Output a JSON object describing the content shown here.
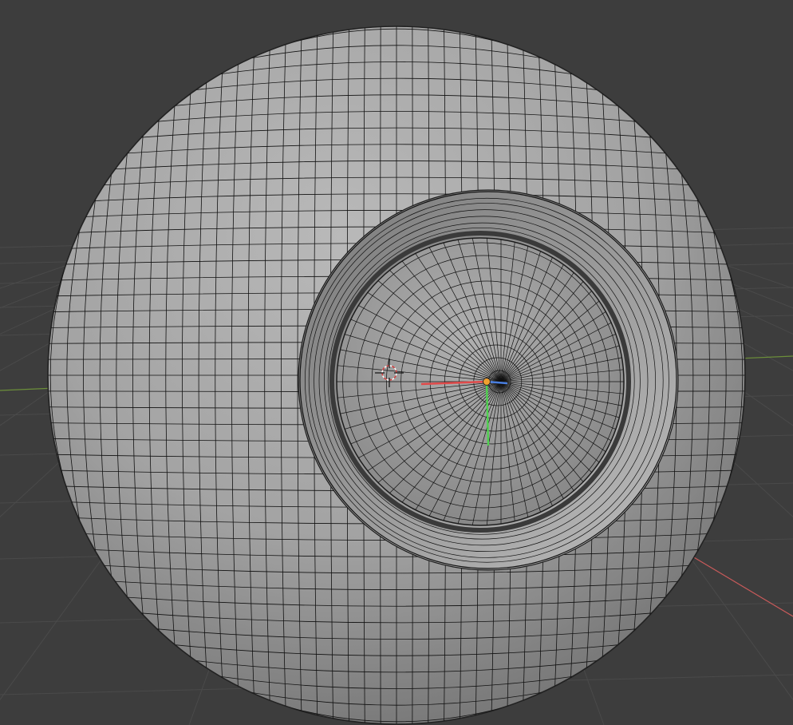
{
  "app": "3D viewport",
  "viewport": {
    "mode": "edit-mode-wireframe-overlay",
    "mesh": {
      "type": "sphere",
      "feature": "recessed-circular-socket"
    }
  },
  "colors": {
    "background": "#3d3d3d",
    "grid_line": "#4a4a4a",
    "axis_x": "#c44a4a",
    "axis_y": "#7fae3a",
    "mesh_face": "#9f9f9f",
    "wire": "#111111",
    "gizmo_x": "#e04a4a",
    "gizmo_y": "#4fd04f",
    "gizmo_z": "#4a7fe0",
    "origin_dot": "#f0a030",
    "cursor": "#d04040"
  },
  "icons": {
    "cursor": "3d-cursor-icon",
    "origin": "object-origin-icon",
    "gizmo": "transform-gizmo-icon"
  }
}
